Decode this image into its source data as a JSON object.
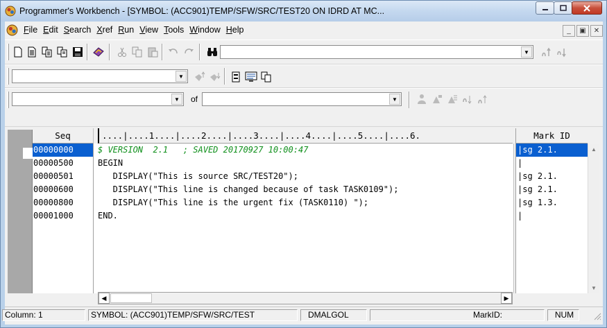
{
  "window": {
    "title": "Programmer's Workbench - [SYMBOL: (ACC901)TEMP/SFW/SRC/TEST20 ON IDRD AT MC..."
  },
  "menu": {
    "items": [
      {
        "label": "File",
        "underline": "F",
        "rest": "ile"
      },
      {
        "label": "Edit",
        "underline": "E",
        "rest": "dit"
      },
      {
        "label": "Search",
        "underline": "S",
        "rest": "earch"
      },
      {
        "label": "Xref",
        "underline": "X",
        "rest": "ref"
      },
      {
        "label": "Run",
        "underline": "R",
        "rest": "un"
      },
      {
        "label": "View",
        "underline": "V",
        "rest": "iew"
      },
      {
        "label": "Tools",
        "underline": "T",
        "rest": "ools"
      },
      {
        "label": "Window",
        "underline": "W",
        "rest": "indow"
      },
      {
        "label": "Help",
        "underline": "H",
        "rest": "elp"
      }
    ]
  },
  "toolbar3": {
    "of_label": "of"
  },
  "editor": {
    "seq_header": "Seq",
    "ruler": "....|....1....|....2....|....3....|....4....|....5....|....6.",
    "mark_header": "Mark ID",
    "lines": [
      {
        "seq": "00000000",
        "code": "$ VERSION  2.1   ; SAVED 20170927 10:00:47",
        "mark": "|sg 2.1."
      },
      {
        "seq": "00000500",
        "code": "BEGIN",
        "mark": "|"
      },
      {
        "seq": "00000501",
        "code": "   DISPLAY(\"This is source SRC/TEST20\");",
        "mark": "|sg 2.1."
      },
      {
        "seq": "00000600",
        "code": "   DISPLAY(\"This line is changed because of task TASK0109\");",
        "mark": "|sg 2.1."
      },
      {
        "seq": "00000800",
        "code": "   DISPLAY(\"This line is the urgent fix (TASK0110) \");",
        "mark": "|sg 1.3."
      },
      {
        "seq": "00001000",
        "code": "END.",
        "mark": "|"
      }
    ]
  },
  "status": {
    "column": "Column: 1",
    "symbol": "SYMBOL: (ACC901)TEMP/SFW/SRC/TEST",
    "language": "DMALGOL",
    "markid": "MarkID:",
    "num": "NUM"
  }
}
